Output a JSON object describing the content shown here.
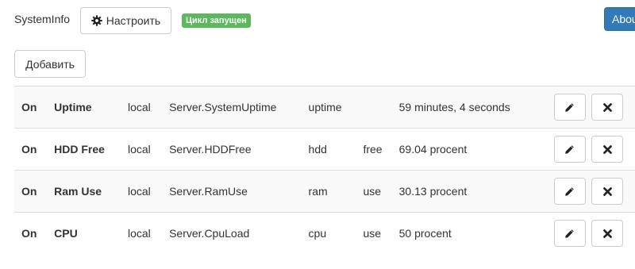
{
  "header": {
    "app_title": "SystemInfo",
    "configure_label": "Настроить",
    "configure_icon": "gear-icon",
    "status_badge": "Цикл запущен",
    "status_color": "#5cb85c",
    "about_label": "About"
  },
  "toolbar": {
    "add_label": "Добавить"
  },
  "rows": [
    {
      "state": "On",
      "name": "Uptime",
      "host": "local",
      "function": "Server.SystemUptime",
      "alias": "uptime",
      "param": "",
      "value": "59 minutes, 4 seconds"
    },
    {
      "state": "On",
      "name": "HDD Free",
      "host": "local",
      "function": "Server.HDDFree",
      "alias": "hdd",
      "param": "free",
      "value": "69.04 procent"
    },
    {
      "state": "On",
      "name": "Ram Use",
      "host": "local",
      "function": "Server.RamUse",
      "alias": "ram",
      "param": "use",
      "value": "30.13 procent"
    },
    {
      "state": "On",
      "name": "CPU",
      "host": "local",
      "function": "Server.CpuLoad",
      "alias": "cpu",
      "param": "use",
      "value": "50 procent"
    }
  ],
  "row_actions": {
    "edit_icon": "pencil-icon",
    "delete_icon": "close-icon"
  },
  "colors": {
    "primary": "#337ab7",
    "success": "#5cb85c",
    "row_stripe": "#f9f9f9"
  }
}
